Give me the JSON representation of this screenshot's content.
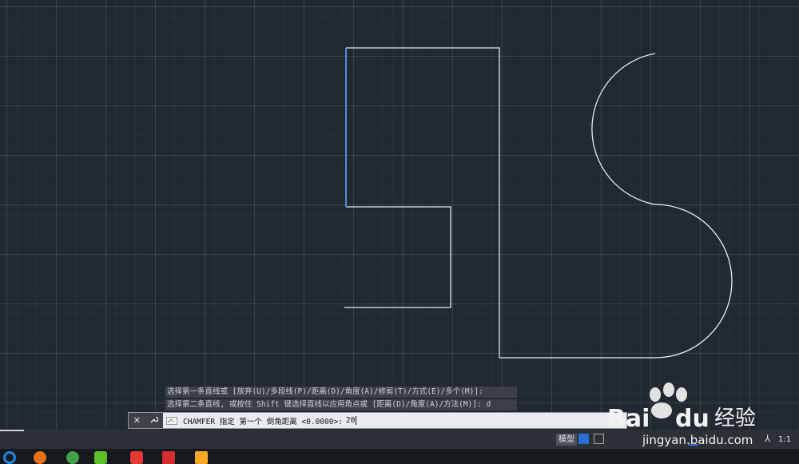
{
  "command_history": [
    "选择第一条直线或 [放弃(U)/多段线(P)/距离(D)/角度(A)/修剪(T)/方式(E)/多个(M)]:",
    "选择第二条直线, 或按住 Shift 键选择直线以应用角点或 [距离(D)/角度(A)/方法(M)]: d"
  ],
  "command_line": {
    "prompt": "CHAMFER 指定 第一个 倒角距离 <0.0000>:",
    "input_value": "20",
    "close_glyph": "✕",
    "settings_glyph": "🔧"
  },
  "status_bar": {
    "model_tab": "模型",
    "scale": "1:1"
  },
  "watermark": {
    "brand": "Bai",
    "brand2": "du",
    "suffix": "经验",
    "url": "jingyan.baidu.com"
  },
  "colors": {
    "canvas_bg": "#212830",
    "line": "#e8ecf0",
    "selected_line": "#4a90e2"
  }
}
